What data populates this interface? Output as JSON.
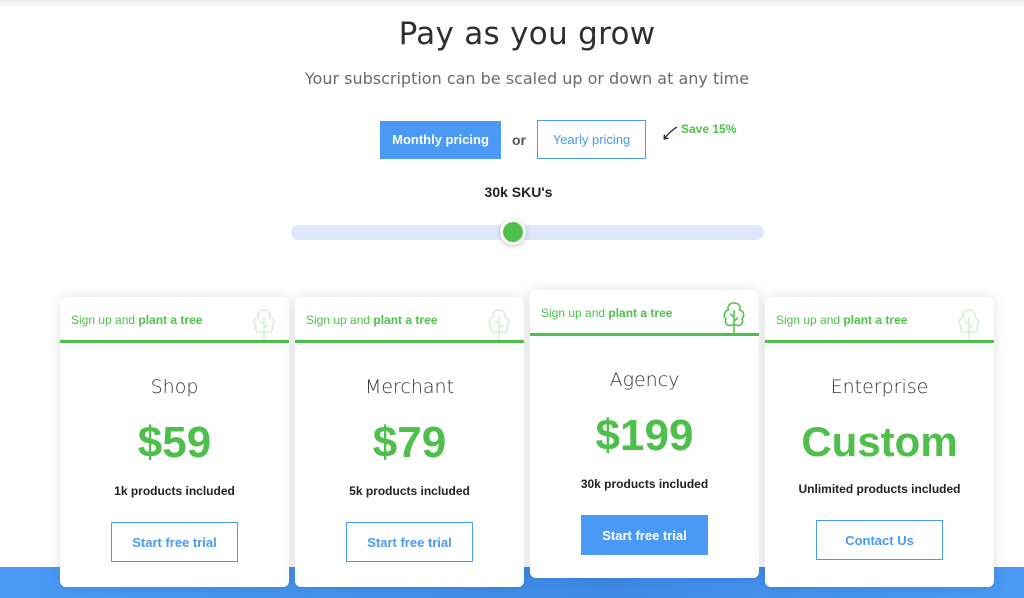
{
  "header": {
    "title": "Pay as you grow",
    "subtitle": "Your subscription can be scaled up or down at any time"
  },
  "billing_toggle": {
    "monthly_label": "Monthly pricing",
    "separator": "or",
    "yearly_label": "Yearly pricing",
    "selected": "monthly",
    "save_badge": "Save 15%",
    "save_icon": "curved-arrow-icon"
  },
  "sku_slider": {
    "label": "30k SKU's",
    "value_fraction": 0.47
  },
  "colors": {
    "primary_blue": "#4a9af5",
    "accent_green": "#4fbf4b",
    "slider_track": "#dde9fb"
  },
  "plans": [
    {
      "promo_prefix": "Sign up and ",
      "promo_bold": "plant a tree",
      "icon": "tree-icon",
      "name": "Shop",
      "price": "$59",
      "included": "1k products included",
      "cta_label": "Start free trial",
      "featured": false
    },
    {
      "promo_prefix": "Sign up and ",
      "promo_bold": "plant a tree",
      "icon": "tree-icon",
      "name": "Merchant",
      "price": "$79",
      "included": "5k products included",
      "cta_label": "Start free trial",
      "featured": false
    },
    {
      "promo_prefix": "Sign up and ",
      "promo_bold": "plant a tree",
      "icon": "tree-icon",
      "name": "Agency",
      "price": "$199",
      "included": "30k products included",
      "cta_label": "Start free trial",
      "featured": true
    },
    {
      "promo_prefix": "Sign up and ",
      "promo_bold": "plant a tree",
      "icon": "tree-icon",
      "name": "Enterprise",
      "price": "Custom",
      "included": "Unlimited products included",
      "cta_label": "Contact Us",
      "featured": false
    }
  ]
}
